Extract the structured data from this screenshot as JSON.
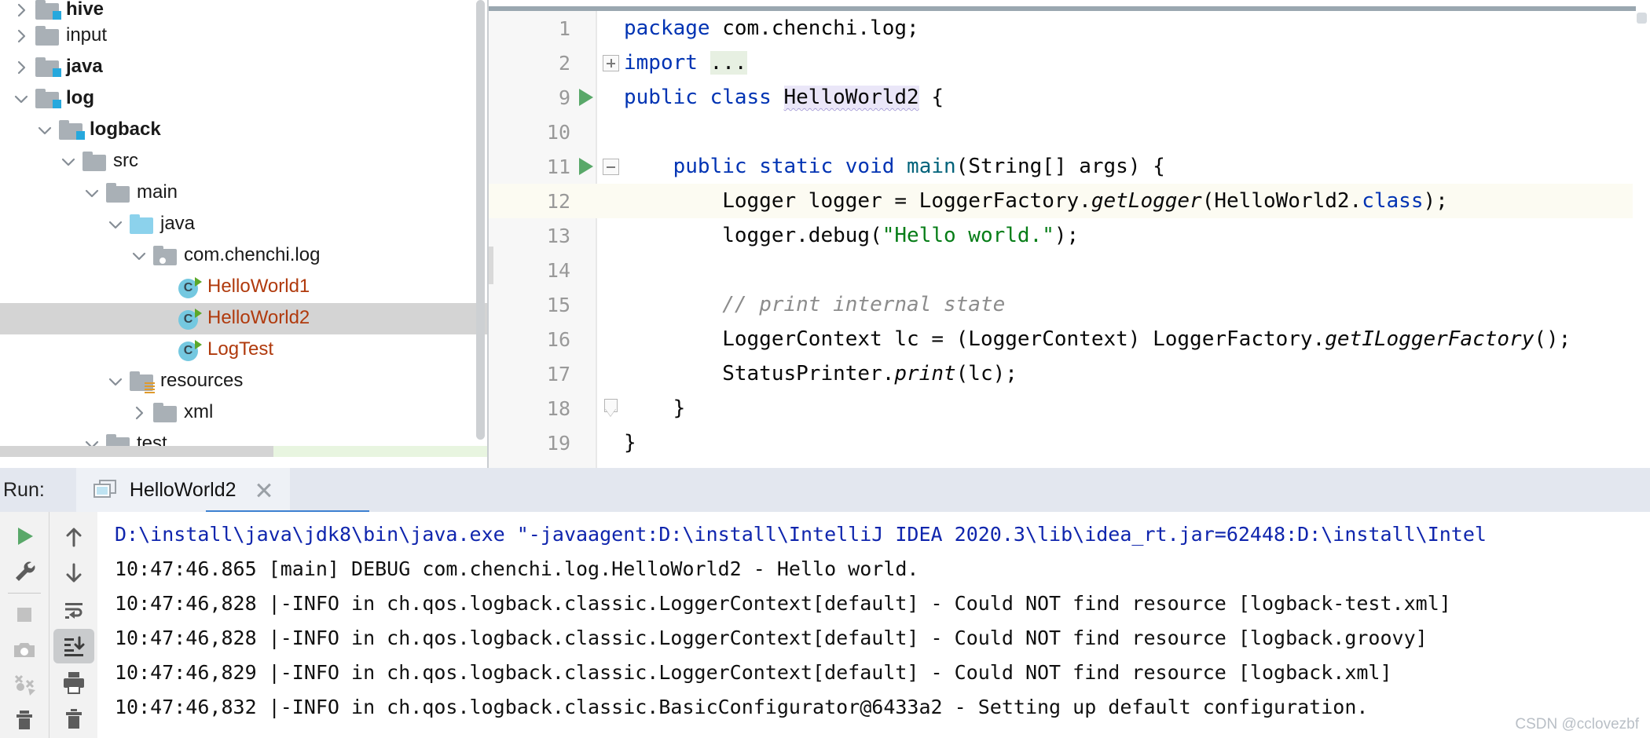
{
  "project_tree": {
    "items": [
      {
        "label": "hive",
        "indent": 0,
        "arrow": "right",
        "icon": "folder-module",
        "bold": true,
        "clipped_top": true
      },
      {
        "label": "input",
        "indent": 0,
        "arrow": "right",
        "icon": "folder",
        "bold": false
      },
      {
        "label": "java",
        "indent": 0,
        "arrow": "right",
        "icon": "folder-module",
        "bold": true
      },
      {
        "label": "log",
        "indent": 0,
        "arrow": "down",
        "icon": "folder-module",
        "bold": true
      },
      {
        "label": "logback",
        "indent": 1,
        "arrow": "down",
        "icon": "folder-module",
        "bold": true
      },
      {
        "label": "src",
        "indent": 2,
        "arrow": "down",
        "icon": "folder",
        "bold": false
      },
      {
        "label": "main",
        "indent": 3,
        "arrow": "down",
        "icon": "folder",
        "bold": false
      },
      {
        "label": "java",
        "indent": 4,
        "arrow": "down",
        "icon": "folder-source",
        "bold": false
      },
      {
        "label": "com.chenchi.log",
        "indent": 5,
        "arrow": "down",
        "icon": "folder-package",
        "bold": false
      },
      {
        "label": "HelloWorld1",
        "indent": 6,
        "arrow": "none",
        "icon": "java-class-runnable",
        "bold": false
      },
      {
        "label": "HelloWorld2",
        "indent": 6,
        "arrow": "none",
        "icon": "java-class-runnable",
        "bold": false,
        "selected": true
      },
      {
        "label": "LogTest",
        "indent": 6,
        "arrow": "none",
        "icon": "java-class-runnable",
        "bold": false
      },
      {
        "label": "resources",
        "indent": 4,
        "arrow": "down",
        "icon": "folder-resources",
        "bold": false
      },
      {
        "label": "xml",
        "indent": 5,
        "arrow": "right",
        "icon": "folder",
        "bold": false
      },
      {
        "label": "test",
        "indent": 3,
        "arrow": "down",
        "icon": "folder",
        "bold": false
      }
    ]
  },
  "editor": {
    "lines": [
      {
        "num": "1",
        "gutter": "none",
        "fold": "none",
        "caret": false,
        "tokens": [
          {
            "t": "package",
            "c": "kw"
          },
          {
            "t": " com.chenchi.log;",
            "c": "pln"
          }
        ]
      },
      {
        "num": "2",
        "gutter": "none",
        "fold": "plus",
        "caret": false,
        "tokens": [
          {
            "t": "import",
            "c": "kw"
          },
          {
            "t": " ",
            "c": "pln"
          },
          {
            "t": "...",
            "c": "pln hl-imports"
          }
        ]
      },
      {
        "num": "9",
        "gutter": "run",
        "fold": "none",
        "caret": false,
        "tokens": [
          {
            "t": "public class ",
            "c": "kw"
          },
          {
            "t": "HelloWorld2",
            "c": "pln hl-usage wavy"
          },
          {
            "t": " {",
            "c": "pln"
          }
        ]
      },
      {
        "num": "10",
        "gutter": "none",
        "fold": "none",
        "caret": false,
        "tokens": []
      },
      {
        "num": "11",
        "gutter": "run",
        "fold": "minus",
        "caret": false,
        "tokens": [
          {
            "t": "    ",
            "c": "pln"
          },
          {
            "t": "public static void ",
            "c": "kw"
          },
          {
            "t": "main",
            "c": "mth"
          },
          {
            "t": "(String[] args) {",
            "c": "pln"
          }
        ]
      },
      {
        "num": "12",
        "gutter": "none",
        "fold": "none",
        "caret": true,
        "tokens": [
          {
            "t": "        Logger logger = LoggerFactory.",
            "c": "pln"
          },
          {
            "t": "getLogger",
            "c": "sta"
          },
          {
            "t": "(HelloWorld2.",
            "c": "pln"
          },
          {
            "t": "class",
            "c": "kw"
          },
          {
            "t": ");",
            "c": "pln"
          }
        ]
      },
      {
        "num": "13",
        "gutter": "none",
        "fold": "none",
        "caret": false,
        "tokens": [
          {
            "t": "        logger.debug(",
            "c": "pln"
          },
          {
            "t": "\"Hello world.\"",
            "c": "str"
          },
          {
            "t": ");",
            "c": "pln"
          }
        ]
      },
      {
        "num": "14",
        "gutter": "none",
        "fold": "none",
        "caret": false,
        "tokens": []
      },
      {
        "num": "15",
        "gutter": "none",
        "fold": "none",
        "caret": false,
        "tokens": [
          {
            "t": "        ",
            "c": "pln"
          },
          {
            "t": "// print internal state",
            "c": "cmt"
          }
        ]
      },
      {
        "num": "16",
        "gutter": "none",
        "fold": "none",
        "caret": false,
        "tokens": [
          {
            "t": "        LoggerContext lc = (LoggerContext) LoggerFactory.",
            "c": "pln"
          },
          {
            "t": "getILoggerFactory",
            "c": "sta"
          },
          {
            "t": "();",
            "c": "pln"
          }
        ]
      },
      {
        "num": "17",
        "gutter": "none",
        "fold": "none",
        "caret": false,
        "tokens": [
          {
            "t": "        StatusPrinter.",
            "c": "pln"
          },
          {
            "t": "print",
            "c": "sta"
          },
          {
            "t": "(lc);",
            "c": "pln"
          }
        ]
      },
      {
        "num": "18",
        "gutter": "none",
        "fold": "end",
        "caret": false,
        "tokens": [
          {
            "t": "    }",
            "c": "pln"
          }
        ]
      },
      {
        "num": "19",
        "gutter": "none",
        "fold": "none",
        "caret": false,
        "tokens": [
          {
            "t": "}",
            "c": "pln"
          }
        ]
      }
    ]
  },
  "run_panel": {
    "label": "Run:",
    "tab_name": "HelloWorld2",
    "toolbar_left": [
      {
        "name": "rerun-button",
        "glyph": "play"
      },
      {
        "name": "settings-button",
        "glyph": "wrench"
      },
      {
        "name": "stop-button",
        "glyph": "stop"
      },
      {
        "name": "screenshot-button",
        "glyph": "camera"
      },
      {
        "name": "dump-threads-button",
        "glyph": "threads"
      },
      {
        "name": "trash-button",
        "glyph": "trash"
      }
    ],
    "toolbar_right": [
      {
        "name": "up-button",
        "glyph": "arrow-up"
      },
      {
        "name": "down-button",
        "glyph": "arrow-down"
      },
      {
        "name": "soft-wrap-button",
        "glyph": "wrap"
      },
      {
        "name": "scroll-to-end-button",
        "glyph": "scroll-end",
        "active": true
      },
      {
        "name": "print-button",
        "glyph": "printer"
      },
      {
        "name": "clear-all-button",
        "glyph": "trash2"
      }
    ],
    "console_lines": [
      {
        "text": "D:\\install\\java\\jdk8\\bin\\java.exe \"-javaagent:D:\\install\\IntelliJ IDEA 2020.3\\lib\\idea_rt.jar=62448:D:\\install\\Intel",
        "kind": "cmd"
      },
      {
        "text": "10:47:46.865 [main] DEBUG com.chenchi.log.HelloWorld2 - Hello world.",
        "kind": "out"
      },
      {
        "text": "10:47:46,828 |-INFO in ch.qos.logback.classic.LoggerContext[default] - Could NOT find resource [logback-test.xml]",
        "kind": "out"
      },
      {
        "text": "10:47:46,828 |-INFO in ch.qos.logback.classic.LoggerContext[default] - Could NOT find resource [logback.groovy]",
        "kind": "out"
      },
      {
        "text": "10:47:46,829 |-INFO in ch.qos.logback.classic.LoggerContext[default] - Could NOT find resource [logback.xml]",
        "kind": "out"
      },
      {
        "text": "10:47:46,832 |-INFO in ch.qos.logback.classic.BasicConfigurator@6433a2 - Setting up default configuration.",
        "kind": "out"
      }
    ],
    "watermark": "CSDN @cclovezbf"
  },
  "colors": {
    "selection": "#d4d4d4",
    "tab_accent": "#3d81d1",
    "run_green": "#59a869",
    "keyword": "#0033b3",
    "string": "#067d17",
    "comment": "#8c8c8c",
    "class_label": "#b03a0d",
    "caret_line": "#fcfbf2",
    "usage_highlight": "#eae6f8",
    "header_bg": "#e3e7ef"
  }
}
